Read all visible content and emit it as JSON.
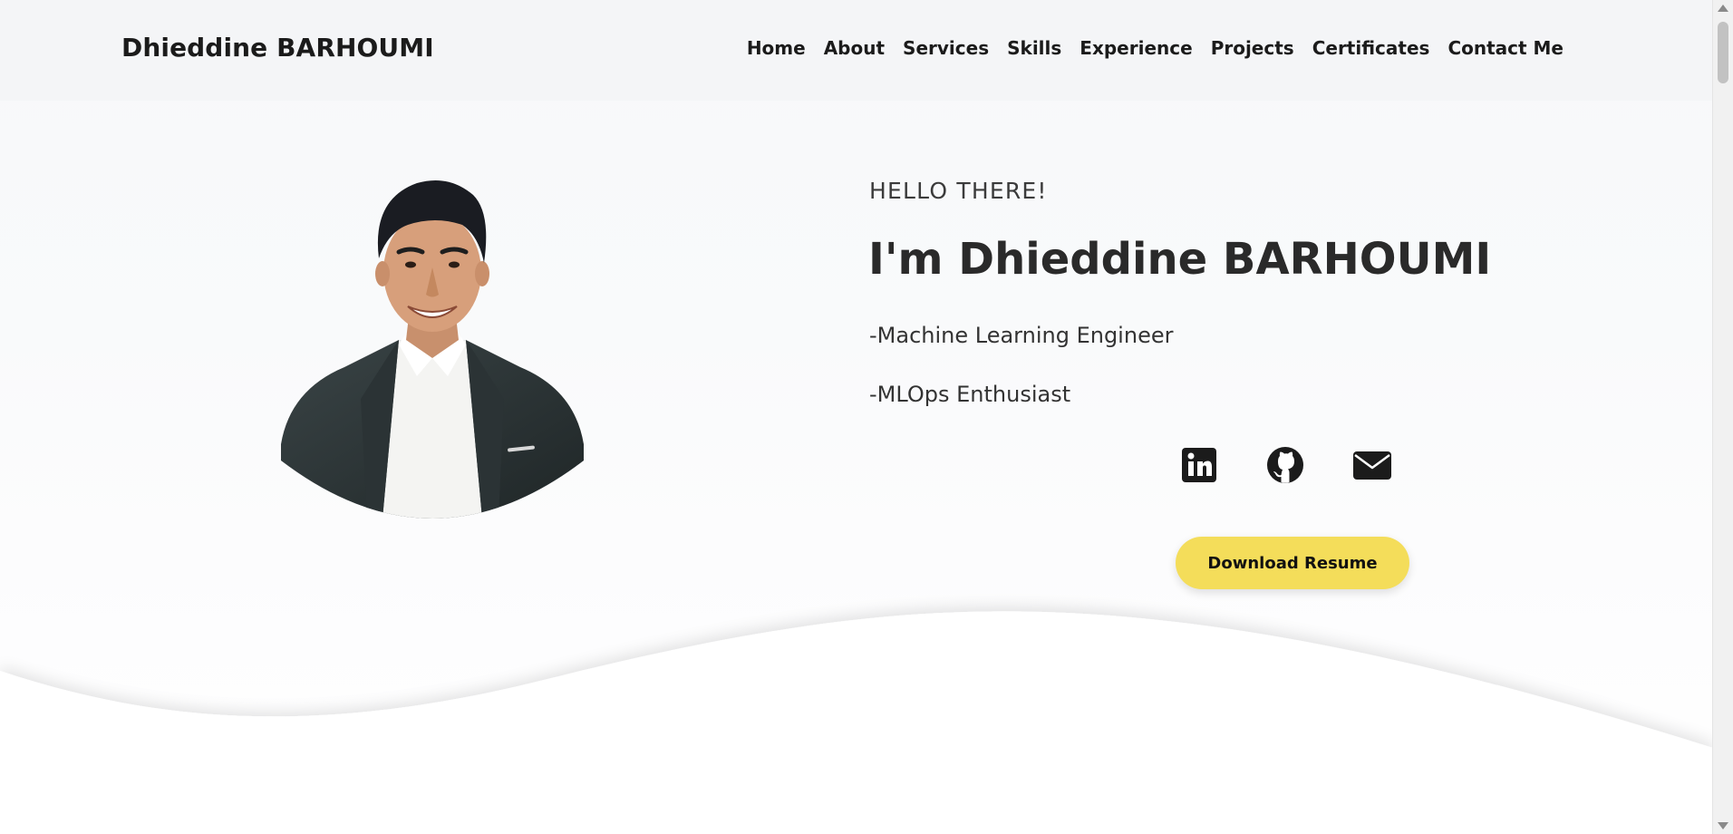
{
  "header": {
    "brand": "Dhieddine BARHOUMI",
    "nav": [
      "Home",
      "About",
      "Services",
      "Skills",
      "Experience",
      "Projects",
      "Certificates",
      "Contact Me"
    ]
  },
  "hero": {
    "greeting": "HELLO THERE!",
    "name": "I'm Dhieddine BARHOUMI",
    "roles": [
      "-Machine Learning Engineer",
      "-MLOps Enthusiast"
    ],
    "social": [
      "linkedin-icon",
      "github-icon",
      "email-icon"
    ],
    "download_label": "Download Resume"
  },
  "colors": {
    "accent_button": "#f4dd5a",
    "navbar_bg": "#f4f5f7",
    "text_dark": "#1b1b1b"
  }
}
